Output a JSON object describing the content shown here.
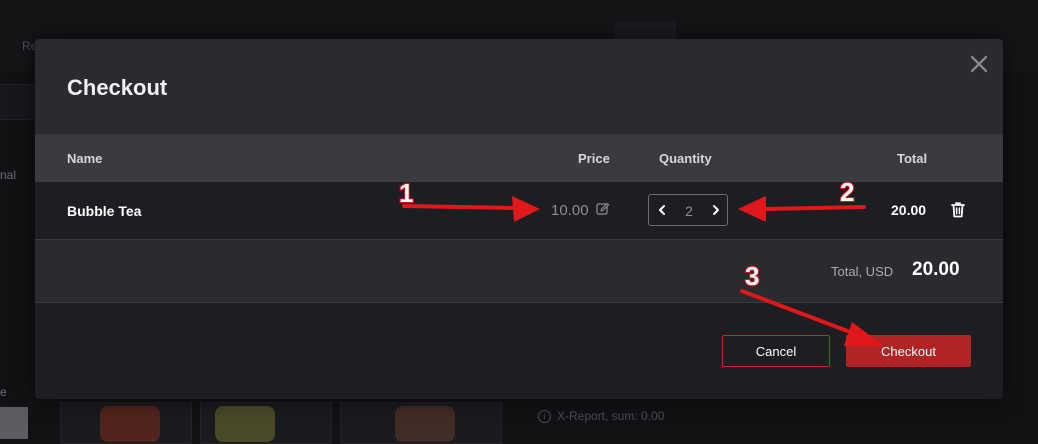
{
  "background": {
    "tab_label": "Re",
    "side_label_1": "nal",
    "side_label_2": "e",
    "xreport_icon": "i",
    "xreport_text": "X-Report, sum: 0.00"
  },
  "modal": {
    "title": "Checkout",
    "columns": {
      "name": "Name",
      "price": "Price",
      "quantity": "Quantity",
      "total": "Total"
    },
    "items": [
      {
        "name": "Bubble Tea",
        "price": "10.00",
        "quantity": "2",
        "total": "20.00"
      }
    ],
    "summary": {
      "label": "Total, USD",
      "value": "20.00"
    },
    "buttons": {
      "cancel": "Cancel",
      "checkout": "Checkout"
    },
    "icons": {
      "close": "close-icon",
      "edit": "pencil-edit-icon",
      "decrement": "chevron-left-icon",
      "increment": "chevron-right-icon",
      "delete": "trash-icon"
    }
  },
  "annotations": {
    "callouts": [
      "1",
      "2",
      "3"
    ],
    "arrow_color": "#e0181b"
  },
  "colors": {
    "accent": "#b12426",
    "modal_bg": "#2a2b2f",
    "header_bg": "#3a3b40",
    "row_bg": "#1d1e22"
  }
}
